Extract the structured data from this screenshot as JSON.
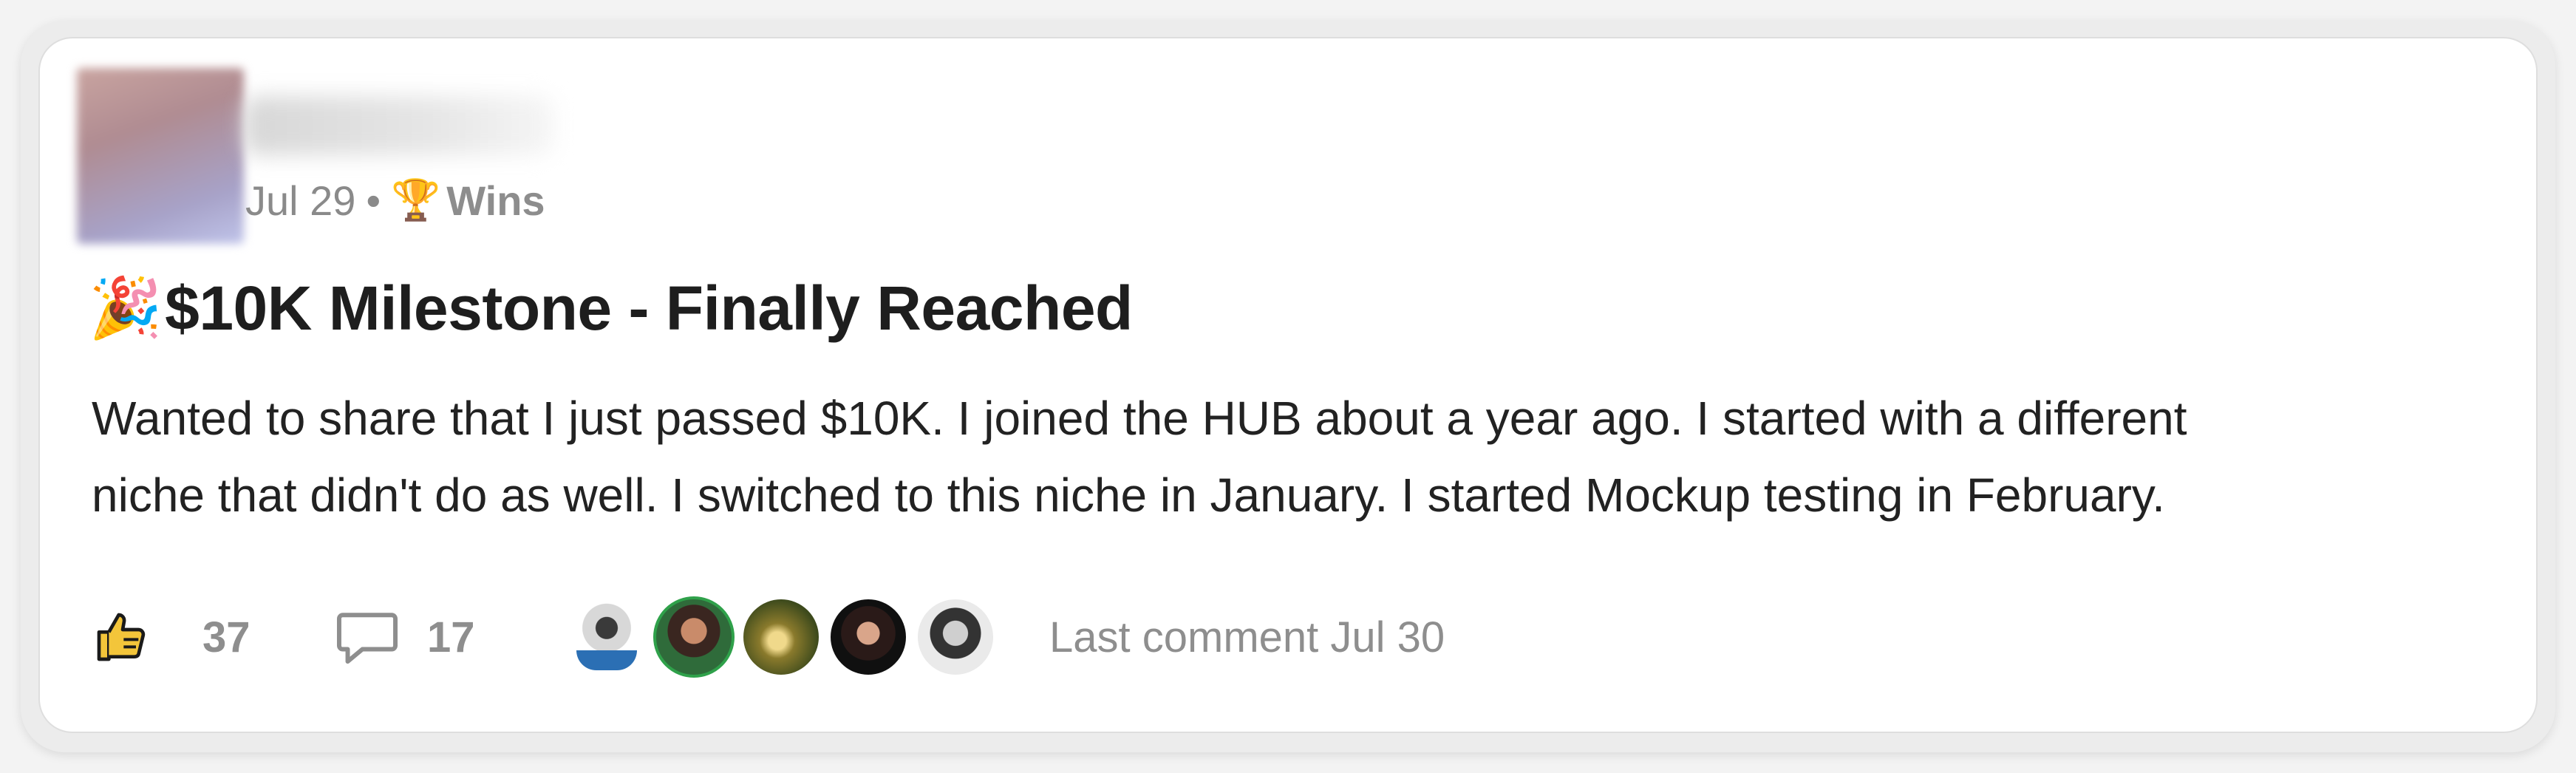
{
  "post": {
    "date": "Jul 29",
    "separator": "•",
    "category_icon": "trophy-icon",
    "category_emoji": "🏆",
    "category": "Wins",
    "title_icon": "party-popper-icon",
    "title_emoji": "🎉",
    "title": "$10K Milestone - Finally Reached",
    "body_lines": [
      "Wanted to share that I just passed $10K. I joined the HUB about a year ago. I started with a different",
      "niche that didn't do as well. I switched to this niche in January. I started Mockup testing in February."
    ]
  },
  "footer": {
    "likes": "37",
    "comments": "17",
    "last_comment": "Last comment Jul 30",
    "commenter_count": 5
  },
  "colors": {
    "muted_text": "#8a8a8a",
    "title_text": "#1e1e1e",
    "body_text": "#222222",
    "like_icon_fill": "#f3c53a"
  }
}
